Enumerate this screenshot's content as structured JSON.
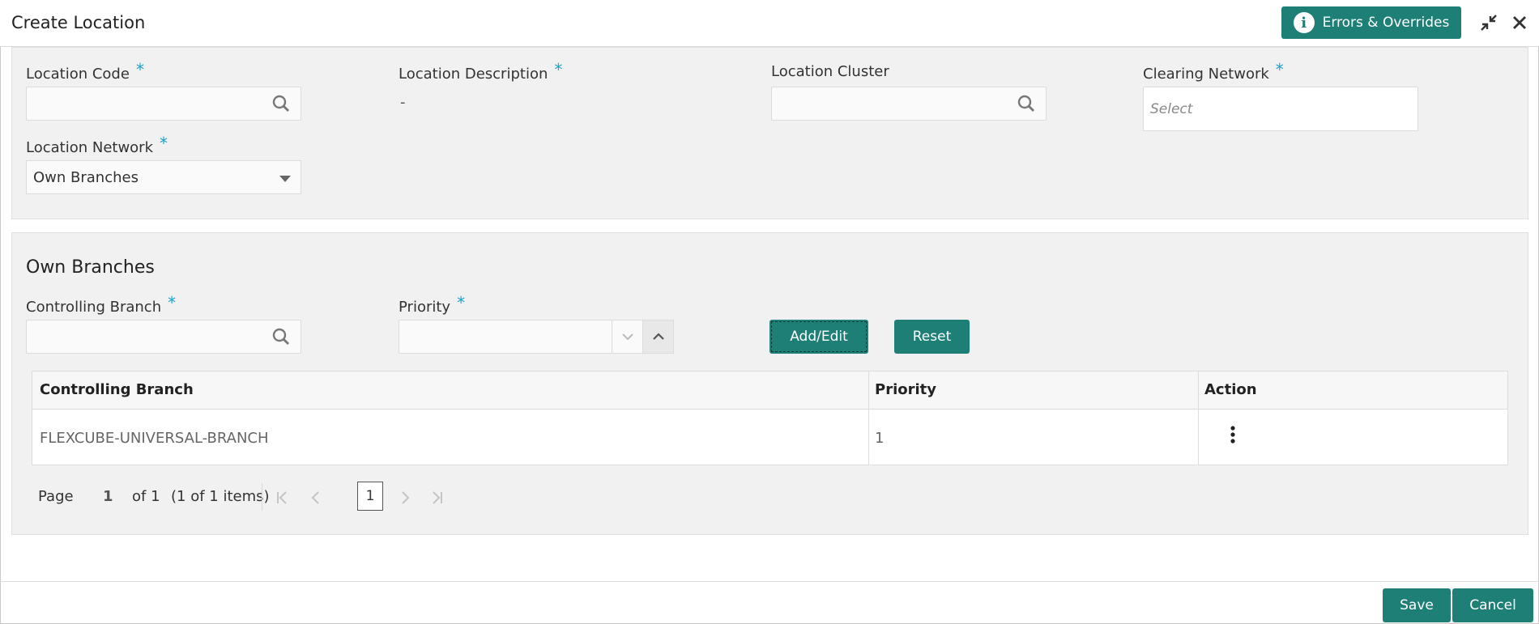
{
  "header": {
    "title": "Create Location",
    "errors_button": "Errors & Overrides",
    "icons": [
      "info-icon",
      "minimize-icon",
      "close-icon"
    ]
  },
  "location": {
    "code_label": "Location Code",
    "code_value": "",
    "description_label": "Location Description",
    "description_value": "-",
    "cluster_label": "Location Cluster",
    "cluster_value": "",
    "clearing_label": "Clearing Network",
    "clearing_placeholder": "Select",
    "network_label": "Location Network",
    "network_value": "Own Branches",
    "required_mark": "*"
  },
  "own_branches": {
    "title": "Own Branches",
    "controlling_branch_label": "Controlling Branch",
    "controlling_branch_value": "",
    "priority_label": "Priority",
    "priority_value": "",
    "add_edit_label": "Add/Edit",
    "reset_label": "Reset",
    "table": {
      "columns": [
        "Controlling Branch",
        "Priority",
        "Action"
      ],
      "rows": [
        {
          "controlling_branch": "FLEXCUBE-UNIVERSAL-BRANCH",
          "priority": "1"
        }
      ]
    },
    "pager": {
      "page_label": "Page",
      "page_current": "1",
      "of_total": "of 1",
      "items": "(1 of 1 items)",
      "page_button": "1"
    }
  },
  "footer": {
    "save_label": "Save",
    "cancel_label": "Cancel"
  },
  "colors": {
    "accent": "#1e7f77",
    "required": "#1aa1c9",
    "panel_bg": "#f1f1f1"
  }
}
